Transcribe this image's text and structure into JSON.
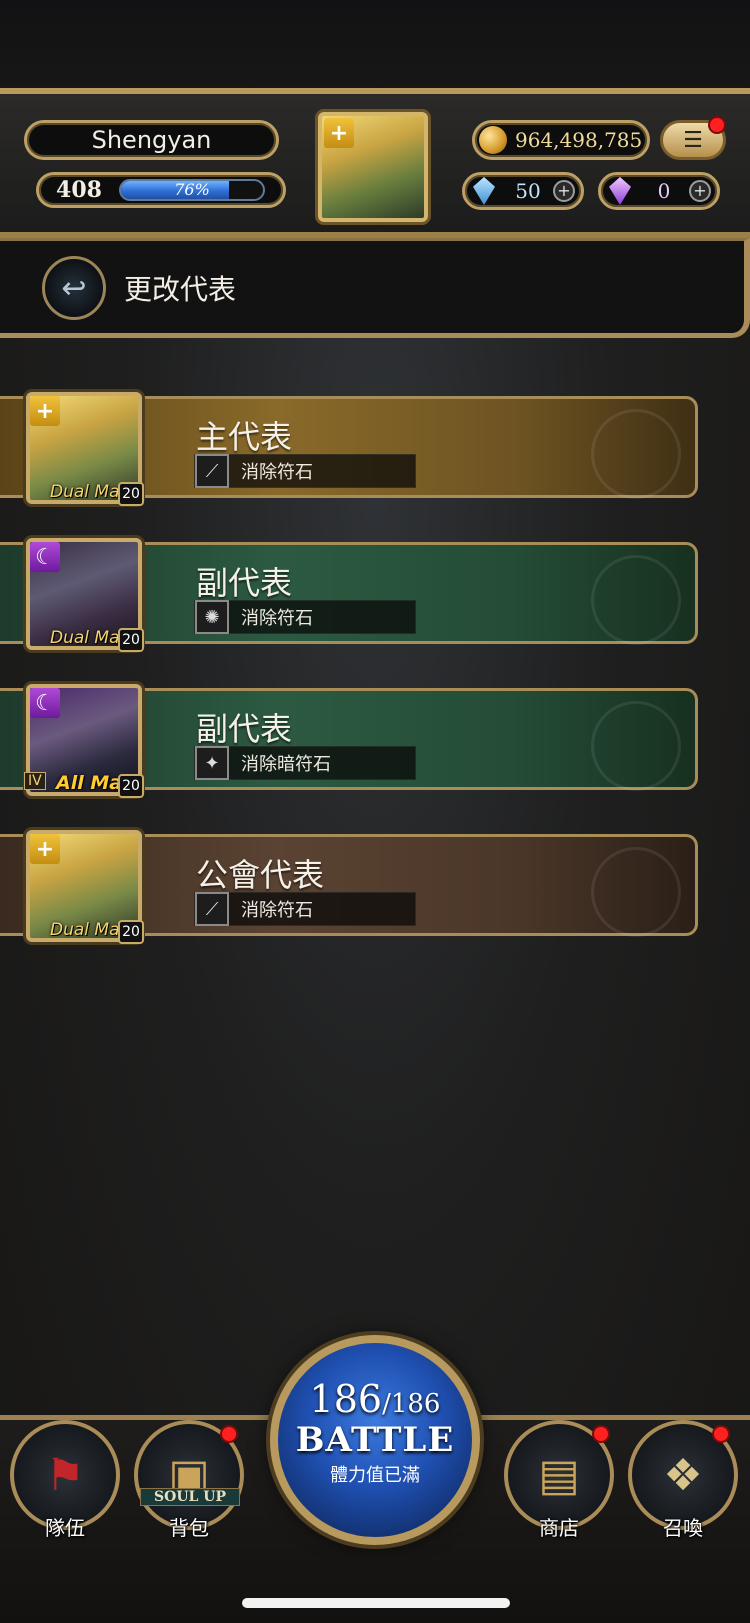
{
  "player": {
    "name": "Shengyan",
    "level": "408",
    "exp_percent_text": "76%",
    "exp_fraction": 0.76
  },
  "currency": {
    "gold": "964,498,785",
    "diamonds": "50",
    "crystals": "0"
  },
  "header": {
    "change_label": "更改代表"
  },
  "representatives": [
    {
      "title": "主代表",
      "skill": "消除符石",
      "max_label": "Dual Max",
      "level": "20",
      "rank": "",
      "style": "gold"
    },
    {
      "title": "副代表",
      "skill": "消除符石",
      "max_label": "Dual Max",
      "level": "20",
      "rank": "",
      "style": "green"
    },
    {
      "title": "副代表",
      "skill": "消除暗符石",
      "max_label": "All Max",
      "level": "20",
      "rank": "IV",
      "style": "green"
    },
    {
      "title": "公會代表",
      "skill": "消除符石",
      "max_label": "Dual Max",
      "level": "20",
      "rank": "",
      "style": "brown"
    }
  ],
  "battle": {
    "stamina_current": "186",
    "stamina_max": "/186",
    "label": "BATTLE",
    "status": "體力值已滿"
  },
  "nav": {
    "team": "隊伍",
    "bag": "背包",
    "soul_up": "SOUL UP",
    "shop": "商店",
    "summon": "召喚"
  },
  "colors": {
    "accent_gold": "#b89a5e",
    "exp_blue": "#2f6fd6",
    "notification_red": "#ff2020"
  }
}
